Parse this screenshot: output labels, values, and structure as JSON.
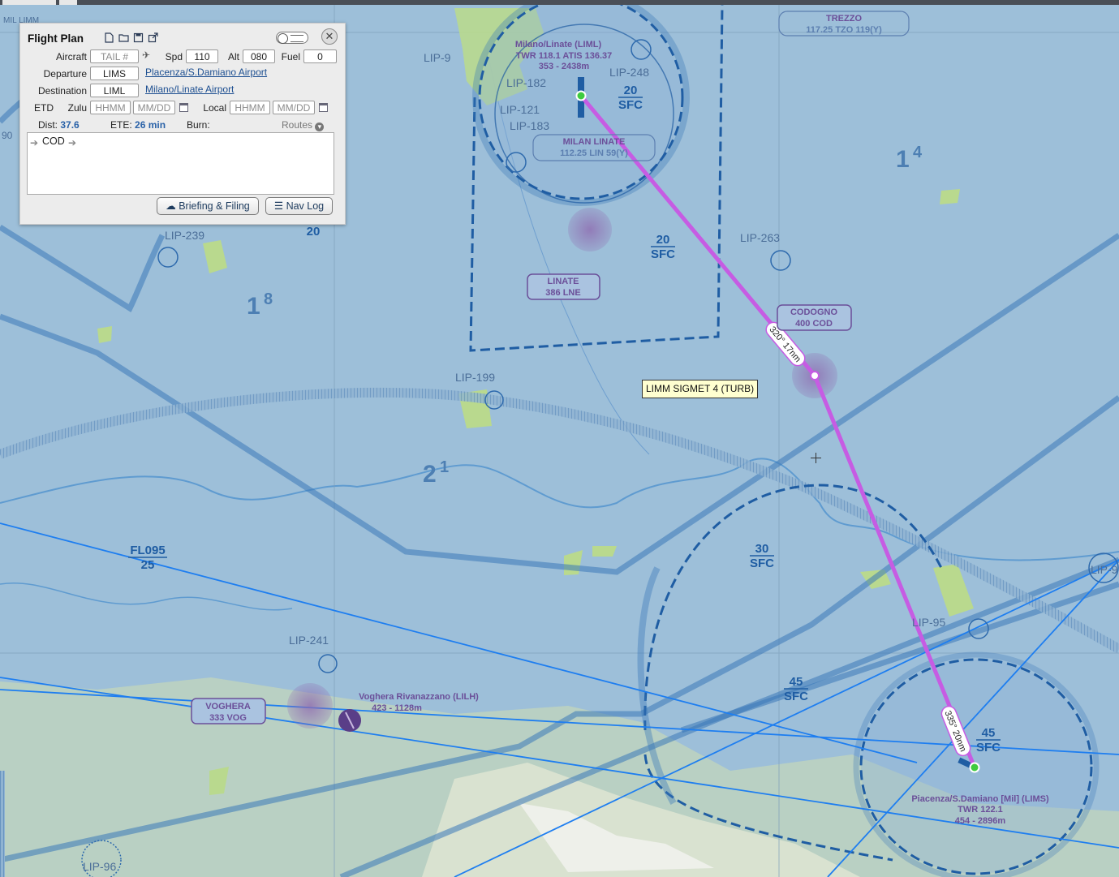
{
  "map": {
    "sectional_labels": {
      "lip_9": "LIP-9",
      "lip_182": "LIP-182",
      "lip_121": "LIP-121",
      "lip_183": "LIP-183",
      "lip_248": "LIP-248",
      "lip_263": "LIP-263",
      "lip_239": "LIP-239",
      "lip_199": "LIP-199",
      "lip_241": "LIP-241",
      "lip_96": "LIP-96",
      "lip_95": "LIP-95",
      "lip_9_right": "LIP-9",
      "milan_label": "MIL LIMM",
      "ninety": "90"
    },
    "airports": {
      "linate_name": "Milano/Linate (LIML)",
      "linate_freq": "TWR 118.1 ATIS 136.37",
      "linate_elev": "353 - 2438m",
      "voghera_name": "Voghera Rivanazzano (LILH)",
      "voghera_elev": "423 - 1128m",
      "piacenza_name": "Piacenza/S.Damiano [Mil] (LIMS)",
      "piacenza_freq": "TWR 122.1",
      "piacenza_elev": "454 - 2896m"
    },
    "navaids": {
      "trezzo_name": "TREZZO",
      "trezzo_freq": "117.25 TZO 119(Y)",
      "milan_linate_name": "MILAN LINATE",
      "milan_linate_freq": "112.25 LIN 59(Y)",
      "linate_ndb_name": "LINATE",
      "linate_ndb_freq": "386 LNE",
      "codogno_name": "CODOGNO",
      "codogno_freq": "400 COD",
      "voghera_name": "VOGHERA",
      "voghera_freq": "333 VOG"
    },
    "airspace": {
      "a1_top": "20",
      "a1_bot": "SFC",
      "a2_top": "20",
      "a2_bot": "SFC",
      "a3_top": "30",
      "a3_bot": "SFC",
      "a4_top": "45",
      "a4_bot": "SFC",
      "a5_top": "45",
      "a5_bot": "SFC",
      "fl_top": "FL095",
      "fl_bot": "25",
      "twenty": "20"
    },
    "grid_mef": {
      "g14_big": "1",
      "g14_small": "4",
      "g18_big": "1",
      "g18_small": "8",
      "g21_big": "2",
      "g21_small": "1"
    },
    "route": {
      "leg1_label": "320° 17nm",
      "leg2_label": "335° 20nm"
    }
  },
  "flight_plan": {
    "title": "Flight Plan",
    "close_glyph": "✕",
    "aircraft_label": "Aircraft",
    "aircraft_placeholder": "TAIL #",
    "plane_glyph": "✈",
    "spd_label": "Spd",
    "spd_value": "110",
    "alt_label": "Alt",
    "alt_value": "080",
    "fuel_label": "Fuel",
    "fuel_value": "0",
    "departure_label": "Departure",
    "departure_value": "LIMS",
    "departure_name": "Placenza/S.Damiano Airport",
    "destination_label": "Destination",
    "destination_value": "LIML",
    "destination_name": "Milano/Linate Airport",
    "etd_label": "ETD",
    "zulu_label": "Zulu",
    "time_placeholder": "HHMM",
    "date_placeholder": "MM/DD",
    "local_label": "Local",
    "dist_label": "Dist:",
    "dist_value": "37.6",
    "ete_label": "ETE:",
    "ete_value": "26 min",
    "burn_label": "Burn:",
    "routes_label": "Routes",
    "routes_glyph": "▾",
    "route_waypoint": "COD",
    "route_arrow": "➔",
    "briefing_button": "Briefing & Filing",
    "briefing_glyph": "☁",
    "navlog_button": "Nav Log",
    "navlog_glyph": "☰"
  },
  "tooltip": {
    "text": "LIMM SIGMET 4 (TURB)"
  },
  "colors": {
    "map_base": "#9dbfd9",
    "airspace_blue": "#2f6fb3",
    "route_magenta": "#c65ce3",
    "vor_purple": "#7a5c9c",
    "terrain": "#cfe0c4"
  }
}
